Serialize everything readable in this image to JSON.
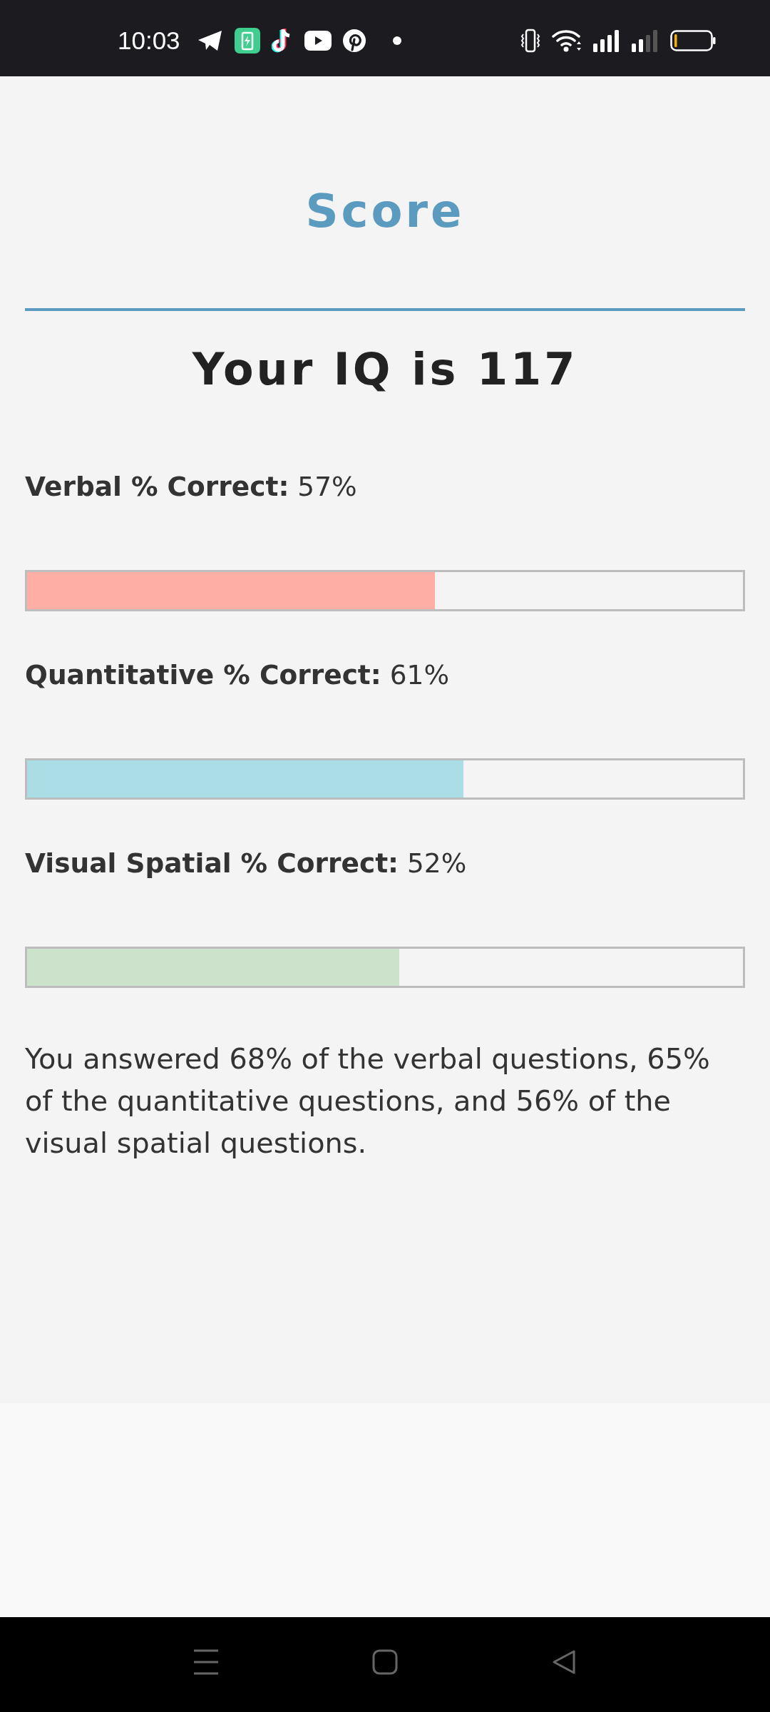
{
  "status_bar": {
    "time": "10:03"
  },
  "title": "Score",
  "headline": "Your IQ is 117",
  "scores": [
    {
      "label": "**Verbal % Correct:** 57%",
      "level": 0.57,
      "color": "#ffaea5"
    },
    {
      "label": "**Quantitative % Correct:** 61%",
      "level": 0.61,
      "color": "#abdde6"
    },
    {
      "label": "**Visual Spatial % Correct:** 52%",
      "level": 0.52,
      "color": "#cde2cb"
    }
  ],
  "summary": "You answered 68% of the verbal questions, 65% of the quantitative questions, and 56% of the visual spatial questions."
}
